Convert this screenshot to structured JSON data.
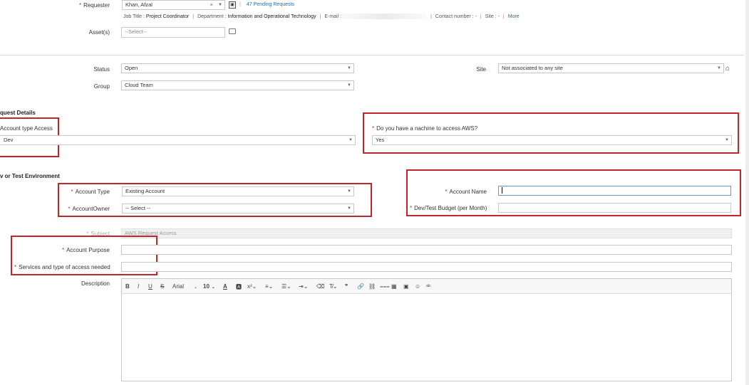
{
  "requester": {
    "label": "Requester",
    "value": "Khan, Afzal",
    "pending": "47 Pending Requests",
    "job_title_label": "Job Title :",
    "job_title": "Project Coordinator",
    "department_label": "Department :",
    "department": "Information and Operational Technology",
    "email_label": "E-mail :",
    "contact_label": "Contact number : -",
    "site_label": "Site : -",
    "more": "More"
  },
  "assets": {
    "label": "Asset(s)",
    "placeholder": "--Select--"
  },
  "status": {
    "label": "Status",
    "value": "Open"
  },
  "site": {
    "label": "Site",
    "value": "Not associated to any site"
  },
  "group": {
    "label": "Group",
    "value": "Cloud Team"
  },
  "request_details": {
    "title": "quest Details",
    "account_type_access_label": "Account type Access",
    "account_type_access_value": "Dev",
    "machine_question": "Do you have a nachine to access AWS?",
    "machine_answer": "Yes"
  },
  "env": {
    "title": "v or Test Environment",
    "account_type_label": "Account Type",
    "account_type_value": "Existing Account",
    "account_owner_label": "AccountOwner",
    "account_owner_value": "-- Select --",
    "account_name_label": "Account Name",
    "budget_label": "Dev/Test Budget (per Month)"
  },
  "subject": {
    "label": "Subject",
    "value": "AWS Request Access"
  },
  "purpose": {
    "label": "Account Purpose"
  },
  "services": {
    "label": "Services and type of access needed"
  },
  "description": {
    "label": "Description"
  },
  "editor": {
    "font": "Arial",
    "size": "10"
  },
  "colors": {
    "required": "#d9232e",
    "highlight": "#c1262d",
    "link": "#1f6fb5"
  }
}
